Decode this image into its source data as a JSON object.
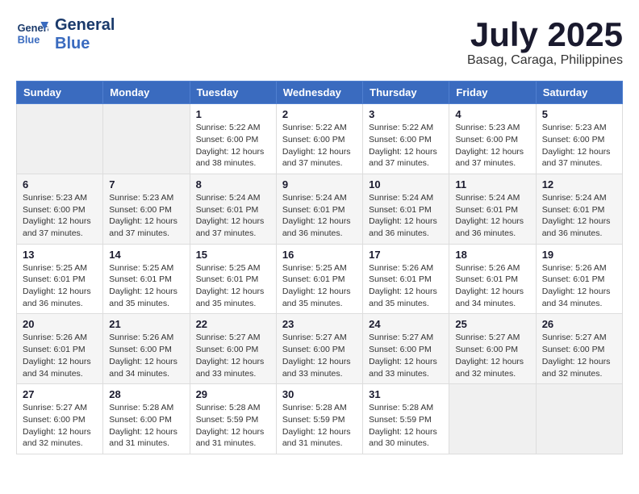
{
  "header": {
    "logo_line1": "General",
    "logo_line2": "Blue",
    "month": "July 2025",
    "location": "Basag, Caraga, Philippines"
  },
  "weekdays": [
    "Sunday",
    "Monday",
    "Tuesday",
    "Wednesday",
    "Thursday",
    "Friday",
    "Saturday"
  ],
  "weeks": [
    [
      {
        "day": "",
        "sunrise": "",
        "sunset": "",
        "daylight": ""
      },
      {
        "day": "",
        "sunrise": "",
        "sunset": "",
        "daylight": ""
      },
      {
        "day": "1",
        "sunrise": "Sunrise: 5:22 AM",
        "sunset": "Sunset: 6:00 PM",
        "daylight": "Daylight: 12 hours and 38 minutes."
      },
      {
        "day": "2",
        "sunrise": "Sunrise: 5:22 AM",
        "sunset": "Sunset: 6:00 PM",
        "daylight": "Daylight: 12 hours and 37 minutes."
      },
      {
        "day": "3",
        "sunrise": "Sunrise: 5:22 AM",
        "sunset": "Sunset: 6:00 PM",
        "daylight": "Daylight: 12 hours and 37 minutes."
      },
      {
        "day": "4",
        "sunrise": "Sunrise: 5:23 AM",
        "sunset": "Sunset: 6:00 PM",
        "daylight": "Daylight: 12 hours and 37 minutes."
      },
      {
        "day": "5",
        "sunrise": "Sunrise: 5:23 AM",
        "sunset": "Sunset: 6:00 PM",
        "daylight": "Daylight: 12 hours and 37 minutes."
      }
    ],
    [
      {
        "day": "6",
        "sunrise": "Sunrise: 5:23 AM",
        "sunset": "Sunset: 6:00 PM",
        "daylight": "Daylight: 12 hours and 37 minutes."
      },
      {
        "day": "7",
        "sunrise": "Sunrise: 5:23 AM",
        "sunset": "Sunset: 6:00 PM",
        "daylight": "Daylight: 12 hours and 37 minutes."
      },
      {
        "day": "8",
        "sunrise": "Sunrise: 5:24 AM",
        "sunset": "Sunset: 6:01 PM",
        "daylight": "Daylight: 12 hours and 37 minutes."
      },
      {
        "day": "9",
        "sunrise": "Sunrise: 5:24 AM",
        "sunset": "Sunset: 6:01 PM",
        "daylight": "Daylight: 12 hours and 36 minutes."
      },
      {
        "day": "10",
        "sunrise": "Sunrise: 5:24 AM",
        "sunset": "Sunset: 6:01 PM",
        "daylight": "Daylight: 12 hours and 36 minutes."
      },
      {
        "day": "11",
        "sunrise": "Sunrise: 5:24 AM",
        "sunset": "Sunset: 6:01 PM",
        "daylight": "Daylight: 12 hours and 36 minutes."
      },
      {
        "day": "12",
        "sunrise": "Sunrise: 5:24 AM",
        "sunset": "Sunset: 6:01 PM",
        "daylight": "Daylight: 12 hours and 36 minutes."
      }
    ],
    [
      {
        "day": "13",
        "sunrise": "Sunrise: 5:25 AM",
        "sunset": "Sunset: 6:01 PM",
        "daylight": "Daylight: 12 hours and 36 minutes."
      },
      {
        "day": "14",
        "sunrise": "Sunrise: 5:25 AM",
        "sunset": "Sunset: 6:01 PM",
        "daylight": "Daylight: 12 hours and 35 minutes."
      },
      {
        "day": "15",
        "sunrise": "Sunrise: 5:25 AM",
        "sunset": "Sunset: 6:01 PM",
        "daylight": "Daylight: 12 hours and 35 minutes."
      },
      {
        "day": "16",
        "sunrise": "Sunrise: 5:25 AM",
        "sunset": "Sunset: 6:01 PM",
        "daylight": "Daylight: 12 hours and 35 minutes."
      },
      {
        "day": "17",
        "sunrise": "Sunrise: 5:26 AM",
        "sunset": "Sunset: 6:01 PM",
        "daylight": "Daylight: 12 hours and 35 minutes."
      },
      {
        "day": "18",
        "sunrise": "Sunrise: 5:26 AM",
        "sunset": "Sunset: 6:01 PM",
        "daylight": "Daylight: 12 hours and 34 minutes."
      },
      {
        "day": "19",
        "sunrise": "Sunrise: 5:26 AM",
        "sunset": "Sunset: 6:01 PM",
        "daylight": "Daylight: 12 hours and 34 minutes."
      }
    ],
    [
      {
        "day": "20",
        "sunrise": "Sunrise: 5:26 AM",
        "sunset": "Sunset: 6:01 PM",
        "daylight": "Daylight: 12 hours and 34 minutes."
      },
      {
        "day": "21",
        "sunrise": "Sunrise: 5:26 AM",
        "sunset": "Sunset: 6:00 PM",
        "daylight": "Daylight: 12 hours and 34 minutes."
      },
      {
        "day": "22",
        "sunrise": "Sunrise: 5:27 AM",
        "sunset": "Sunset: 6:00 PM",
        "daylight": "Daylight: 12 hours and 33 minutes."
      },
      {
        "day": "23",
        "sunrise": "Sunrise: 5:27 AM",
        "sunset": "Sunset: 6:00 PM",
        "daylight": "Daylight: 12 hours and 33 minutes."
      },
      {
        "day": "24",
        "sunrise": "Sunrise: 5:27 AM",
        "sunset": "Sunset: 6:00 PM",
        "daylight": "Daylight: 12 hours and 33 minutes."
      },
      {
        "day": "25",
        "sunrise": "Sunrise: 5:27 AM",
        "sunset": "Sunset: 6:00 PM",
        "daylight": "Daylight: 12 hours and 32 minutes."
      },
      {
        "day": "26",
        "sunrise": "Sunrise: 5:27 AM",
        "sunset": "Sunset: 6:00 PM",
        "daylight": "Daylight: 12 hours and 32 minutes."
      }
    ],
    [
      {
        "day": "27",
        "sunrise": "Sunrise: 5:27 AM",
        "sunset": "Sunset: 6:00 PM",
        "daylight": "Daylight: 12 hours and 32 minutes."
      },
      {
        "day": "28",
        "sunrise": "Sunrise: 5:28 AM",
        "sunset": "Sunset: 6:00 PM",
        "daylight": "Daylight: 12 hours and 31 minutes."
      },
      {
        "day": "29",
        "sunrise": "Sunrise: 5:28 AM",
        "sunset": "Sunset: 5:59 PM",
        "daylight": "Daylight: 12 hours and 31 minutes."
      },
      {
        "day": "30",
        "sunrise": "Sunrise: 5:28 AM",
        "sunset": "Sunset: 5:59 PM",
        "daylight": "Daylight: 12 hours and 31 minutes."
      },
      {
        "day": "31",
        "sunrise": "Sunrise: 5:28 AM",
        "sunset": "Sunset: 5:59 PM",
        "daylight": "Daylight: 12 hours and 30 minutes."
      },
      {
        "day": "",
        "sunrise": "",
        "sunset": "",
        "daylight": ""
      },
      {
        "day": "",
        "sunrise": "",
        "sunset": "",
        "daylight": ""
      }
    ]
  ]
}
